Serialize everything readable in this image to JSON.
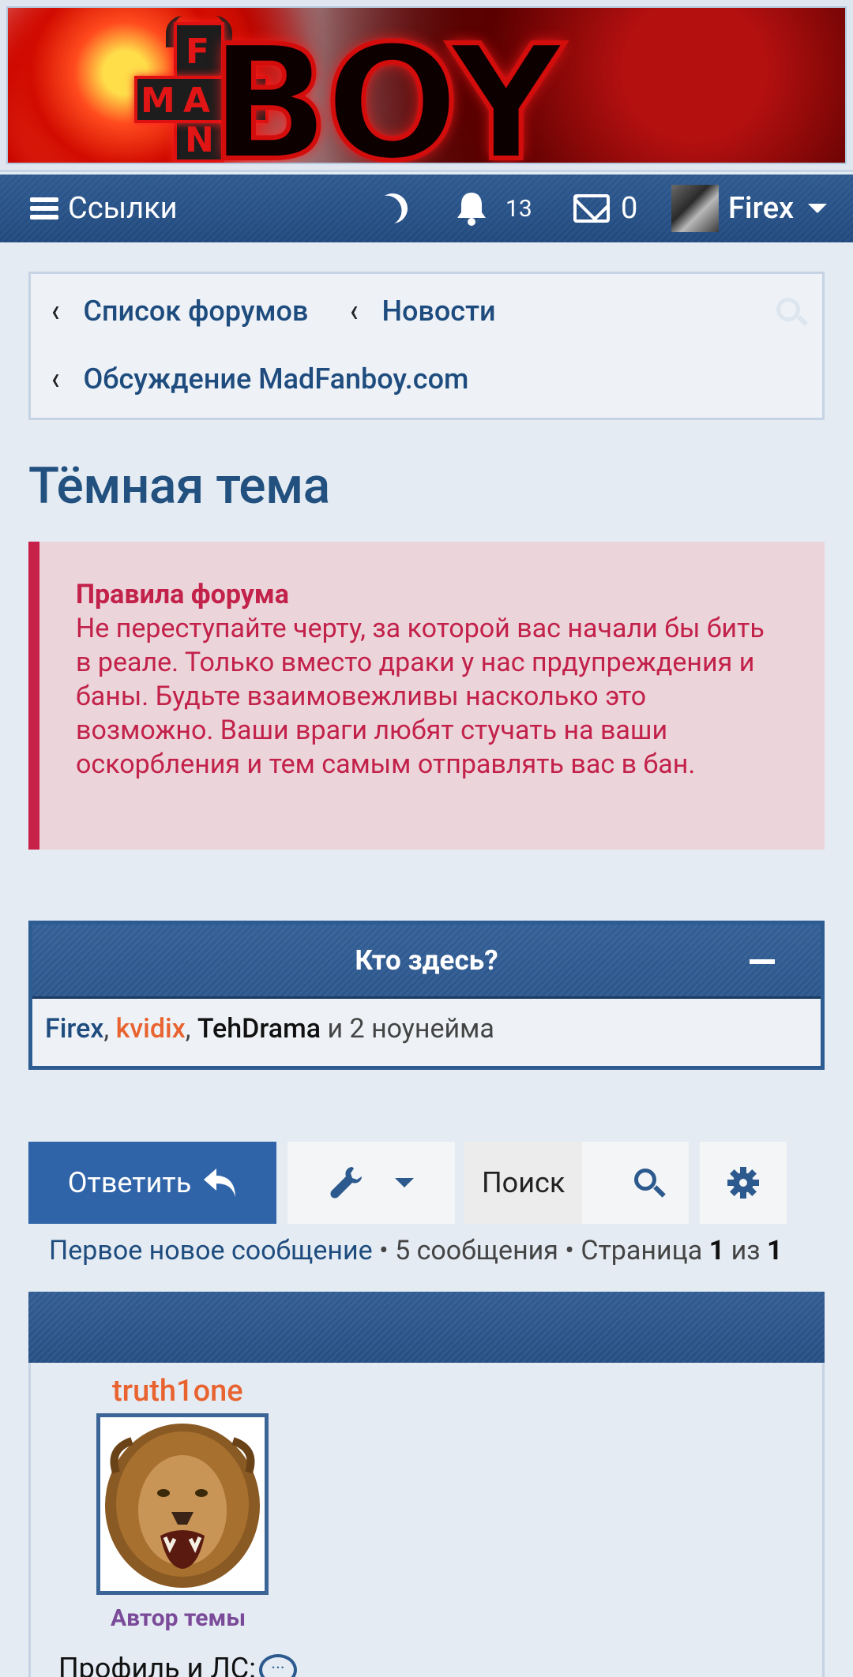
{
  "banner": {
    "logo_word": "BOY",
    "cross_letters": {
      "top": "F",
      "left": "M",
      "mid": "A",
      "right": "D",
      "bottom": "N"
    }
  },
  "navbar": {
    "links_label": "Ссылки",
    "notifications_count": "13",
    "messages_count": "0",
    "username": "Firex"
  },
  "breadcrumb": {
    "items": [
      "Список форумов",
      "Новости",
      "Обсуждение MadFanboy.com"
    ],
    "chevron": "‹"
  },
  "page": {
    "title": "Тёмная тема"
  },
  "rules": {
    "title": "Правила форума",
    "text": "Не переступайте черту, за которой вас начали бы бить в реале. Только вместо драки у нас прдупреждения и баны. Будьте взаимовежливы насколько это возможно. Ваши враги любят стучать на ваши оскорбления и тем самым отправлять вас в бан."
  },
  "who_here": {
    "title": "Кто здесь?",
    "users": [
      "Firex",
      "kvidix",
      "TehDrama"
    ],
    "separator": ",",
    "tail": " и 2 ноунейма"
  },
  "actions": {
    "reply_label": "Ответить",
    "search_label": "Поиск"
  },
  "pagination": {
    "first_new": "Первое новое сообщение",
    "messages": "5 сообщения",
    "page_prefix": "Страница",
    "page_current": "1",
    "page_of": "из",
    "page_total": "1",
    "bullet": "•"
  },
  "post": {
    "author": "truth1one",
    "role": "Автор темы",
    "profile_label": "Профиль и ЛС:",
    "bubble": "..."
  },
  "colors": {
    "accent": "#2f64a8",
    "nav": "#21497e",
    "link": "#1e4c7e",
    "rules_text": "#c2214a",
    "rules_bg": "#ecd5da",
    "orange_user": "#e8632f",
    "role": "#7b4b9a"
  },
  "icons": [
    "hamburger-icon",
    "moon-icon",
    "bell-icon",
    "envelope-icon",
    "chevron-down-icon",
    "search-icon",
    "wrench-icon",
    "reply-arrow-icon",
    "gear-icon",
    "minus-icon",
    "chat-bubble-icon"
  ]
}
